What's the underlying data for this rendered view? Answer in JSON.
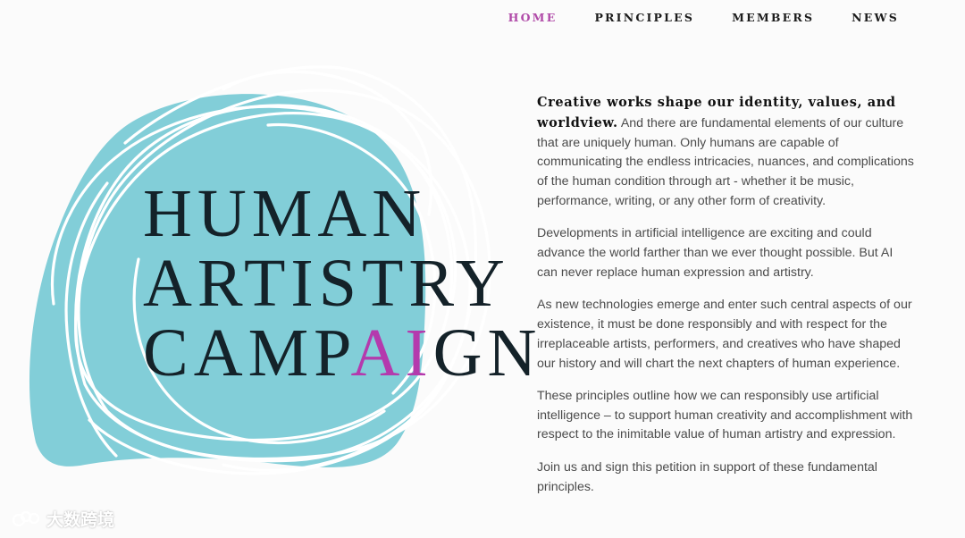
{
  "nav": {
    "items": [
      {
        "label": "HOME",
        "active": true
      },
      {
        "label": "PRINCIPLES",
        "active": false
      },
      {
        "label": "MEMBERS",
        "active": false
      },
      {
        "label": "NEWS",
        "active": false
      }
    ]
  },
  "hero": {
    "line1": "HUMAN",
    "line2": "ARTISTRY",
    "line3_pre": "CAMP",
    "line3_highlight": "AI",
    "line3_post": "GN"
  },
  "content": {
    "p1_lead": "Creative works shape our identity, values, and worldview.",
    "p1_rest": " And there are fundamental elements of our culture that are uniquely human. Only humans are capable of communicating the endless intricacies, nuances, and complications of the human condition through art - whether it be music, performance, writing, or any other form of creativity.",
    "p2": "Developments in artificial intelligence are exciting and could advance the world farther than we ever thought possible. But AI can never replace human expression and artistry.",
    "p3": "As new technologies emerge and enter such central aspects of our existence, it must be done responsibly and with respect for the irreplaceable artists, performers, and creatives who have shaped our history and will chart the next chapters of human experience.",
    "p4": "These principles outline how we can responsibly use artificial intelligence  – to support human creativity and accomplishment with respect to the inimitable value of human artistry and expression.",
    "p5": "Join us and sign this petition in support of these fundamental principles."
  },
  "watermark": {
    "text": "大数跨境",
    "icon": "brand-logo-icon"
  },
  "colors": {
    "accent": "#b43aad",
    "nav_active": "#b04aa8",
    "blob": "#82ced8",
    "title": "#142229"
  }
}
